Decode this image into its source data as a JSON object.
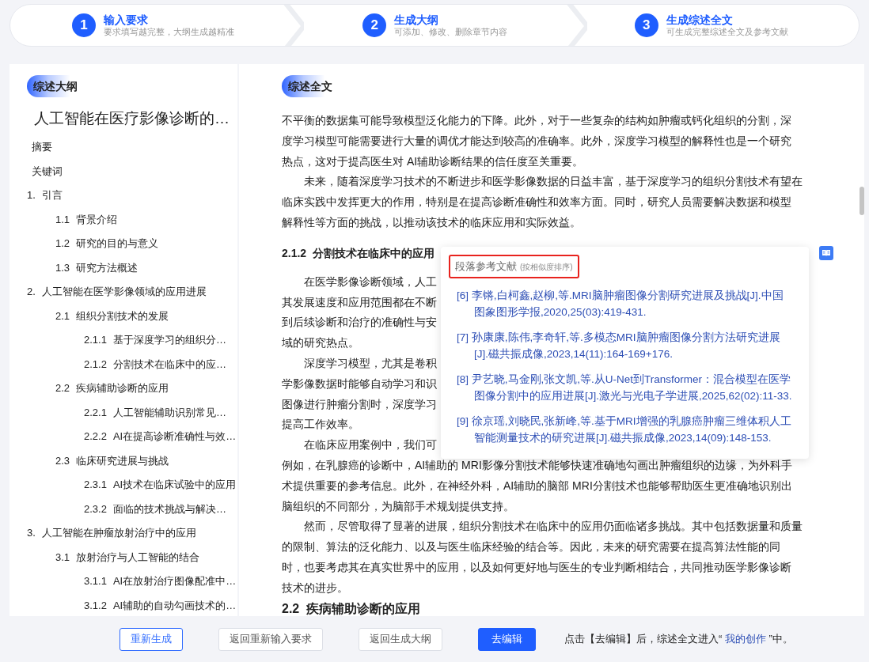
{
  "steps": [
    {
      "number": "1",
      "title": "输入要求",
      "subtitle": "要求填写越完整，大纲生成越精准"
    },
    {
      "number": "2",
      "title": "生成大纲",
      "subtitle": "可添加、修改、删除章节内容"
    },
    {
      "number": "3",
      "title": "生成综述全文",
      "subtitle": "可生成完整综述全文及参考文献"
    }
  ],
  "outline": {
    "badge": "综述大纲",
    "title": "人工智能在医疗影像诊断的…",
    "items": [
      {
        "label": "摘要"
      },
      {
        "label": "关键词"
      },
      {
        "number": "1.",
        "label": "引言",
        "children": [
          {
            "number": "1.1",
            "label": "背景介绍"
          },
          {
            "number": "1.2",
            "label": "研究的目的与意义"
          },
          {
            "number": "1.3",
            "label": "研究方法概述"
          }
        ]
      },
      {
        "number": "2.",
        "label": "人工智能在医学影像领域的应用进展",
        "children": [
          {
            "number": "2.1",
            "label": "组织分割技术的发展",
            "children": [
              {
                "number": "2.1.1",
                "label": "基于深度学习的组织分…"
              },
              {
                "number": "2.1.2",
                "label": "分割技术在临床中的应…"
              }
            ]
          },
          {
            "number": "2.2",
            "label": "疾病辅助诊断的应用",
            "children": [
              {
                "number": "2.2.1",
                "label": "人工智能辅助识别常见…"
              },
              {
                "number": "2.2.2",
                "label": "AI在提高诊断准确性与效…"
              }
            ]
          },
          {
            "number": "2.3",
            "label": "临床研究进展与挑战",
            "children": [
              {
                "number": "2.3.1",
                "label": "AI技术在临床试验中的应用"
              },
              {
                "number": "2.3.2",
                "label": "面临的技术挑战与解决…"
              }
            ]
          }
        ]
      },
      {
        "number": "3.",
        "label": "人工智能在肿瘤放射治疗中的应用",
        "children": [
          {
            "number": "3.1",
            "label": "放射治疗与人工智能的结合",
            "children": [
              {
                "number": "3.1.1",
                "label": "AI在放射治疗图像配准中…"
              },
              {
                "number": "3.1.2",
                "label": "AI辅助的自动勾画技术的…"
              }
            ]
          }
        ]
      }
    ]
  },
  "article": {
    "badge": "综述全文",
    "blocks": [
      {
        "kind": "paragraph",
        "indent": false,
        "lines": [
          "不平衡的数据集可能导致模型泛化能力的下降。此外，对于一些复杂的结构如肿瘤或钙化组织的分割，深",
          "度学习模型可能需要进行大量的调优才能达到较高的准确率。此外，深度学习模型的解释性也是一个研究",
          "热点，这对于提高医生对 AI辅助诊断结果的信任度至关重要。"
        ]
      },
      {
        "kind": "paragraph",
        "indent": true,
        "lines": [
          "未来，随着深度学习技术的不断进步和医学影像数据的日益丰富，基于深度学习的组织分割技术有望在",
          "临床实践中发挥更大的作用，特别是在提高诊断准确性和效率方面。同时，研究人员需要解决数据和模型",
          "解释性等方面的挑战，以推动该技术的临床应用和实际效益。"
        ]
      },
      {
        "kind": "heading",
        "lines": [
          "2.1.2  分割技术在临床中的应用"
        ]
      },
      {
        "kind": "paragraph",
        "indent": true,
        "lines": [
          "在医学影像诊断领域，人工",
          "其发展速度和应用范围都在不断",
          "到后续诊断和治疗的准确性与安",
          "域的研究热点。"
        ]
      },
      {
        "kind": "paragraph",
        "indent": true,
        "lines": [
          "深度学习模型，尤其是卷积",
          "学影像数据时能够自动学习和识",
          "图像进行肿瘤分割时，深度学习",
          "提高工作效率。"
        ]
      },
      {
        "kind": "paragraph",
        "indent": true,
        "lines": [
          "在临床应用案例中，我们可"
        ]
      },
      {
        "kind": "paragraph",
        "indent": false,
        "lines": [
          "例如，在乳腺癌的诊断中，AI辅助的 MRI影像分割技术能够快速准确地勾画出肿瘤组织的边缘，为外科手",
          "术提供重要的参考信息。此外，在神经外科，AI辅助的脑部 MRI分割技术也能够帮助医生更准确地识别出",
          "脑组织的不同部分，为脑部手术规划提供支持。"
        ]
      },
      {
        "kind": "paragraph",
        "indent": true,
        "lines": [
          "然而，尽管取得了显著的进展，组织分割技术在临床中的应用仍面临诸多挑战。其中包括数据量和质量",
          "的限制、算法的泛化能力、以及与医生临床经验的结合等。因此，未来的研究需要在提高算法性能的同",
          "时，也要考虑其在真实世界中的应用，以及如何更好地与医生的专业判断相结合，共同推动医学影像诊断",
          "技术的进步。"
        ]
      },
      {
        "kind": "heading",
        "lines": [
          "2.2  疾病辅助诊断的应用"
        ]
      }
    ]
  },
  "references_popup": {
    "title": "段落参考文献",
    "note": "(按相似度排序)",
    "items": [
      "[6] 李锵,白柯鑫,赵柳,等.MRI脑肿瘤图像分割研究进展及挑战[J].中国图象图形学报,2020,25(03):419-431.",
      "[7] 孙康康,陈伟,李奇轩,等.多模态MRI脑肿瘤图像分割方法研究进展[J].磁共振成像,2023,14(11):164-169+176.",
      "[8] 尹艺晓,马金刚,张文凯,等.从U-Net到Transformer：混合模型在医学图像分割中的应用进展[J].激光与光电子学进展,2025,62(02):11-33.",
      "[9] 徐京瑶,刘晓民,张新峰,等.基于MRI增强的乳腺癌肿瘤三维体积人工智能测量技术的研究进展[J].磁共振成像,2023,14(09):148-153."
    ]
  },
  "footer": {
    "buttons": [
      {
        "label": "重新生成",
        "kind": "outline"
      },
      {
        "label": "返回重新输入要求",
        "kind": "default"
      },
      {
        "label": "返回生成大纲",
        "kind": "default"
      },
      {
        "label": "去编辑",
        "kind": "primary"
      }
    ],
    "note": "点击【去编辑】后，综述全文进入“ ",
    "note_link": "我的创作",
    "note_end": " ”中。"
  }
}
